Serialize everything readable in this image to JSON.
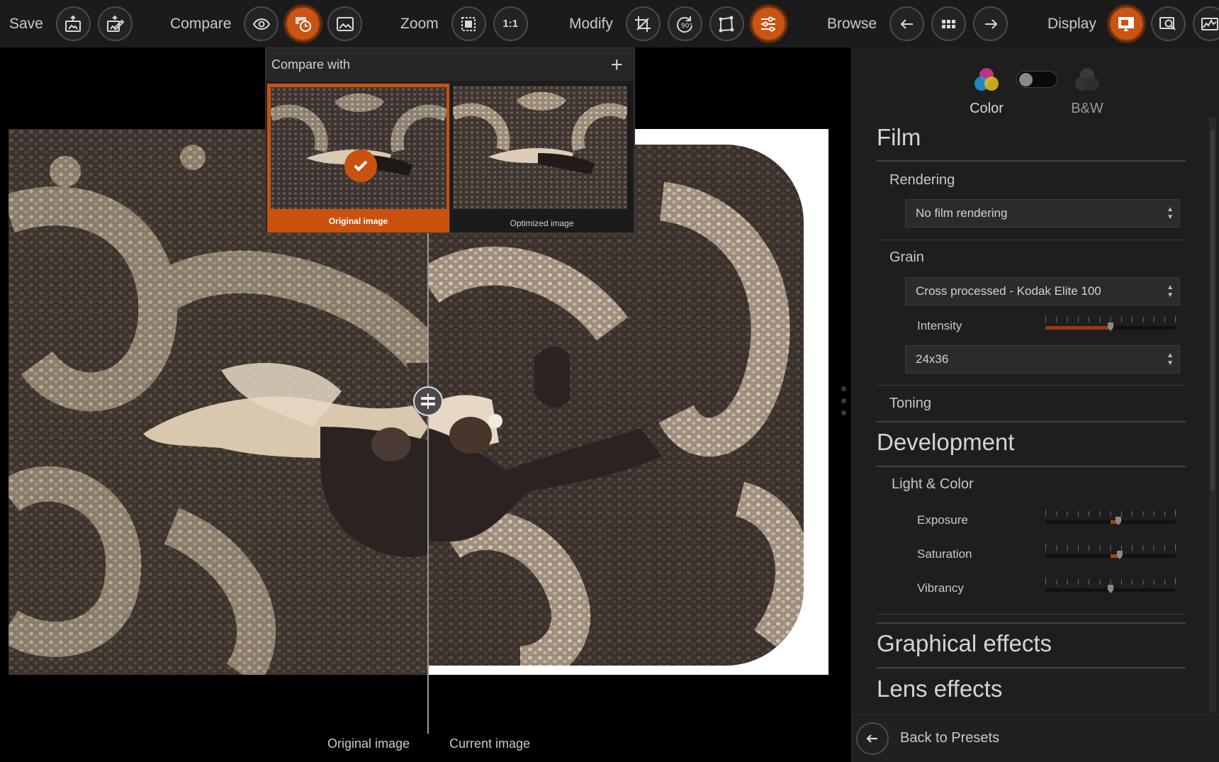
{
  "toolbar": {
    "save": {
      "label": "Save",
      "buttons": [
        "export-icon",
        "export-edit-icon"
      ]
    },
    "compare": {
      "label": "Compare",
      "buttons": [
        "eye-icon",
        "compare-history-icon",
        "image-icon"
      ]
    },
    "zoom": {
      "label": "Zoom",
      "buttons": [
        "fit-icon",
        "actual-size"
      ],
      "actual_size_text": "1:1"
    },
    "modify": {
      "label": "Modify",
      "buttons": [
        "crop-icon",
        "rotate-90-icon",
        "perspective-icon",
        "sliders-icon"
      ],
      "rotate_text": "90°"
    },
    "browse": {
      "label": "Browse",
      "buttons": [
        "arrow-left-icon",
        "grid-icon",
        "arrow-right-icon"
      ]
    },
    "display": {
      "label": "Display",
      "buttons": [
        "monitor-icon",
        "loupe-icon",
        "histogram-icon"
      ]
    },
    "accent": "#c95414"
  },
  "compare_popup": {
    "title": "Compare with",
    "thumbnails": [
      {
        "label": "Original image",
        "selected": true
      },
      {
        "label": "Optimized image",
        "selected": false
      }
    ]
  },
  "viewer": {
    "left_caption": "Original image",
    "right_caption": "Current image"
  },
  "panel": {
    "mode": {
      "color_label": "Color",
      "bw_label": "B&W",
      "toggle_on": false
    },
    "film": {
      "title": "Film",
      "rendering": {
        "label": "Rendering",
        "value": "No film rendering"
      },
      "grain": {
        "label": "Grain",
        "type": "Cross processed - Kodak Elite 100",
        "intensity_label": "Intensity",
        "intensity": 0.5,
        "format": "24x36"
      },
      "toning": {
        "label": "Toning"
      }
    },
    "development": {
      "title": "Development",
      "light_color": {
        "label": "Light & Color",
        "exposure_label": "Exposure",
        "exposure": 0.56,
        "saturation_label": "Saturation",
        "saturation": 0.57,
        "vibrancy_label": "Vibrancy",
        "vibrancy": 0.5
      }
    },
    "graphical_effects": {
      "title": "Graphical effects"
    },
    "lens_effects": {
      "title": "Lens effects"
    },
    "back": {
      "label": "Back to Presets"
    }
  }
}
